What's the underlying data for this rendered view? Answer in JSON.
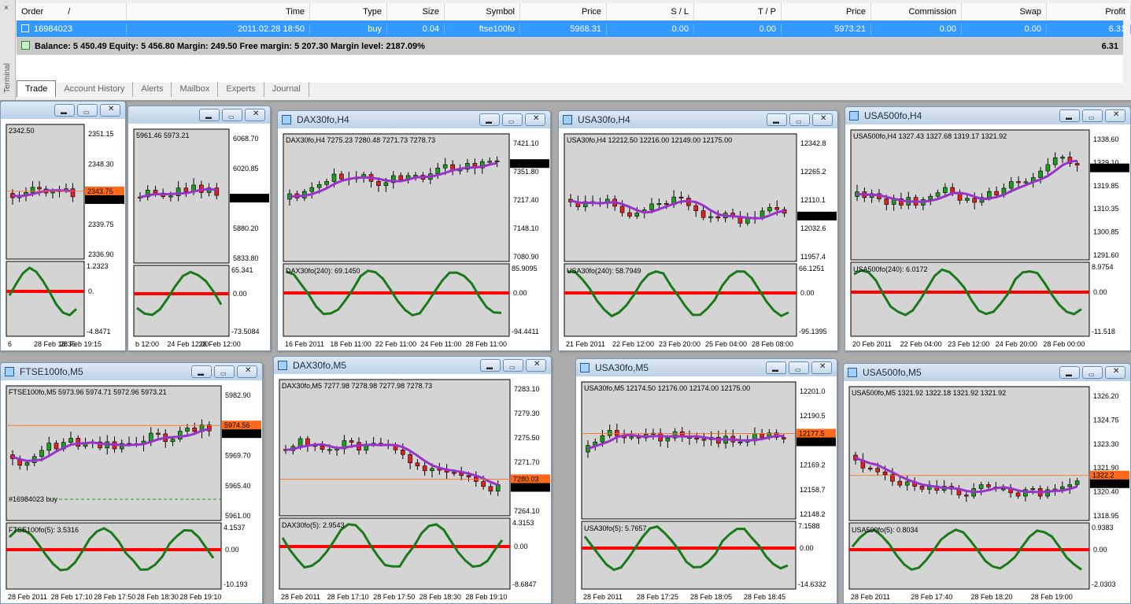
{
  "terminal": {
    "side_label": "Terminal",
    "close_glyph": "×",
    "columns": [
      "Order",
      "Time",
      "Type",
      "Size",
      "Symbol",
      "Price",
      "S / L",
      "T / P",
      "Price",
      "Commission",
      "Swap",
      "Profit"
    ],
    "sort_glyph": "/",
    "order_row": {
      "order": "16984023",
      "time": "2011.02.28 18:50",
      "type": "buy",
      "size": "0.04",
      "symbol": "ftse100fo",
      "price": "5968.31",
      "sl": "0.00",
      "tp": "0.00",
      "cur_price": "5973.21",
      "commission": "0.00",
      "swap": "0.00",
      "profit": "6.31"
    },
    "balance_text": "Balance: 5 450.49  Equity: 5 456.80  Margin: 249.50  Free margin: 5 207.30  Margin level: 2187.09%",
    "balance_profit": "6.31",
    "tabs": [
      "Trade",
      "Account History",
      "Alerts",
      "Mailbox",
      "Experts",
      "Journal"
    ]
  },
  "window_buttons": {
    "min": "▬",
    "max": "▭",
    "close": "✕"
  },
  "colors": {
    "bull": "#1a9e1a",
    "bear": "#e02020",
    "ma": "#9933cc",
    "osc": "#1a7a1a",
    "zero": "#ff0000",
    "bg": "#d4d4d4",
    "last_price": "#000000",
    "sl_price": "#ff6a1a"
  },
  "windows": [
    {
      "title": "",
      "info": "2342.50",
      "ind": "",
      "cur_label": "2342.50",
      "alt_label": "2343.75",
      "price_ticks": [
        "2351.15",
        "2348.30",
        "2345.45",
        "2339.75",
        "2336.90"
      ],
      "osc_ticks": [
        "1.2323",
        "-4.8471"
      ],
      "time_ticks": [
        "6",
        "28 Feb 18:35",
        "28 Feb 19:15"
      ],
      "zero_label": "0."
    },
    {
      "title": "",
      "info": "5961.46 5973.21",
      "ind": "",
      "cur_label": "5973.21",
      "alt_label": "",
      "price_ticks": [
        "6068.70",
        "6020.85",
        "5926.60",
        "5880.20",
        "5833.80"
      ],
      "osc_ticks": [
        "65.341",
        "-73.5084"
      ],
      "time_ticks": [
        "b 12:00",
        "24 Feb 12:00",
        "28 Feb 12:00"
      ],
      "zero_label": "0.00"
    },
    {
      "title": "DAX30fo,H4",
      "info": "DAX30fo,H4  7275.23 7280.48 7271.73 7278.73",
      "ind": "DAX30fo(240):  69.1450",
      "cur_label": "7278.73",
      "alt_label": "",
      "price_ticks": [
        "7421.10",
        "7351.80",
        "7217.40",
        "7148.10",
        "7080.90"
      ],
      "osc_ticks": [
        "85.9095",
        "-94.4411"
      ],
      "time_ticks": [
        "16 Feb 2011",
        "18 Feb 11:00",
        "22 Feb 11:00",
        "24 Feb 11:00",
        "28 Feb 11:00"
      ],
      "zero_label": "0.00"
    },
    {
      "title": "USA30fo,H4",
      "info": "USA30fo,H4  12212.50 12216.00 12149.00 12175.00",
      "ind": "USA30fo(240):  58.7949",
      "cur_label": "12175.00",
      "alt_label": "",
      "price_ticks": [
        "12342.8",
        "12265.2",
        "12110.1",
        "12032.6",
        "11957.4"
      ],
      "osc_ticks": [
        "66.1251",
        "-95.1395"
      ],
      "time_ticks": [
        "21 Feb 2011",
        "22 Feb 12:00",
        "23 Feb 20:00",
        "25 Feb 04:00",
        "28 Feb 08:00"
      ],
      "zero_label": "0.00"
    },
    {
      "title": "USA500fo,H4",
      "info": "USA500fo,H4  1327.43 1327.68 1319.17 1321.92",
      "ind": "USA500fo(240):  6.0172",
      "cur_label": "1321.92",
      "alt_label": "",
      "price_ticks": [
        "1338.60",
        "1329.10",
        "1319.85",
        "1310.35",
        "1300.85",
        "1291.60"
      ],
      "osc_ticks": [
        "8.9754",
        "-11.518"
      ],
      "time_ticks": [
        "20 Feb 2011",
        "22 Feb 04:00",
        "23 Feb 12:00",
        "24 Feb 20:00",
        "28 Feb 00:00"
      ],
      "zero_label": "0.00"
    },
    {
      "title": "FTSE100fo,M5",
      "info": "FTSE100fo,M5  5973.96 5974.71 5972.96 5973.21",
      "ind": "FTSE100fo(5):  3.5316",
      "cur_label": "5973.21",
      "alt_label": "5974.56",
      "price_ticks": [
        "5982.90",
        "5978.50",
        "5969.70",
        "5965.40",
        "5961.00"
      ],
      "osc_ticks": [
        "4.1537",
        "-10.193"
      ],
      "time_ticks": [
        "28 Feb 2011",
        "28 Feb 17:10",
        "28 Feb 17:50",
        "28 Feb 18:30",
        "28 Feb 19:10"
      ],
      "zero_label": "0.00",
      "trade_label": "#16984023 buy"
    },
    {
      "title": "DAX30fo,M5",
      "info": "DAX30fo,M5  7277.98 7278.98 7277.98 7278.73",
      "ind": "DAX30fo(5):  2.9543",
      "cur_label": "7278.73",
      "alt_label": "7280.03",
      "price_ticks": [
        "7283.10",
        "7279.30",
        "7275.50",
        "7271.70",
        "7267.90",
        "7264.10"
      ],
      "osc_ticks": [
        "4.3153",
        "-8.6847"
      ],
      "time_ticks": [
        "28 Feb 2011",
        "28 Feb 17:10",
        "28 Feb 17:50",
        "28 Feb 18:30",
        "28 Feb 19:10"
      ],
      "zero_label": "0.00"
    },
    {
      "title": "USA30fo,M5",
      "info": "USA30fo,M5  12174.50 12176.00 12174.00 12175.00",
      "ind": "USA30fo(5):  5.7657",
      "cur_label": "12175.00",
      "alt_label": "12177.5",
      "price_ticks": [
        "12201.0",
        "12190.5",
        "12179.8",
        "12169.2",
        "12158.7",
        "12148.2"
      ],
      "osc_ticks": [
        "7.1588",
        "-14.6332"
      ],
      "time_ticks": [
        "28 Feb 2011",
        "28 Feb 17:25",
        "28 Feb 18:05",
        "28 Feb 18:45"
      ],
      "zero_label": "0.00"
    },
    {
      "title": "USA500fo,M5",
      "info": "USA500fo,M5  1321.92 1322.18 1321.92 1321.92",
      "ind": "USA500fo(5):  0.8034",
      "cur_label": "1321.92",
      "alt_label": "1322.2",
      "price_ticks": [
        "1326.20",
        "1324.75",
        "1323.30",
        "1321.90",
        "1320.40",
        "1318.95"
      ],
      "osc_ticks": [
        "0.9383",
        "-2.0303"
      ],
      "time_ticks": [
        "28 Feb 2011",
        "28 Feb 17:40",
        "28 Feb 18:20",
        "28 Feb 19:00"
      ],
      "zero_label": "0.00"
    }
  ]
}
